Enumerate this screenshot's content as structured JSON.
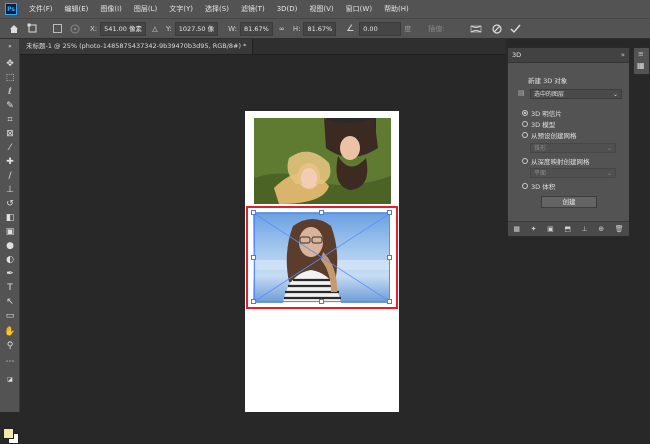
{
  "menubar": {
    "logo": "Ps",
    "items": [
      "文件(F)",
      "编辑(E)",
      "图像(I)",
      "图层(L)",
      "文字(Y)",
      "选择(S)",
      "滤镜(T)",
      "3D(D)",
      "视图(V)",
      "窗口(W)",
      "帮助(H)"
    ]
  },
  "options": {
    "x_label": "X:",
    "x_value": "541.00 像素",
    "y_label": "Y:",
    "y_value": "1027.50 像",
    "w_label": "W:",
    "w_value": "81.67%",
    "h_label": "H:",
    "h_value": "81.67%",
    "angle_value": "0.00",
    "angle_unit": "度",
    "interp_label": "插值:",
    "cancel_icon": "cancel-icon",
    "commit_icon": "check-icon"
  },
  "document": {
    "tab_title": "未标题-1 @ 25% (photo-1485875437342-9b39470b3d95, RGB/8#) *"
  },
  "panel3d": {
    "tab": "3D",
    "section_title": "新建 3D 对象",
    "source_select": "选中的图层",
    "options": [
      {
        "label": "3D 明信片",
        "selected": true
      },
      {
        "label": "3D 模型",
        "selected": false
      },
      {
        "label": "从预设创建网格",
        "selected": false
      },
      {
        "label": "从深度映射创建网格",
        "selected": false
      },
      {
        "label": "3D 体积",
        "selected": false
      }
    ],
    "preset_select": "锥形",
    "depth_select": "平面",
    "create_button": "创建"
  },
  "colors": {
    "foreground": "#f4e9a6",
    "background": "#ffffff",
    "accent_red": "#e0202a",
    "bbox_blue": "#5a8cff"
  }
}
